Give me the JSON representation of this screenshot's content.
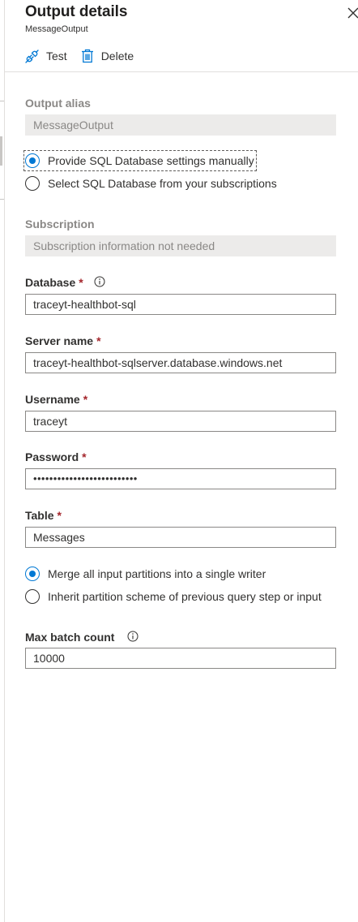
{
  "header": {
    "title": "Output details",
    "subtitle": "MessageOutput"
  },
  "toolbar": {
    "test_label": "Test",
    "delete_label": "Delete"
  },
  "output_alias": {
    "label": "Output alias",
    "value": "MessageOutput"
  },
  "db_source": {
    "options": [
      "Provide SQL Database settings manually",
      "Select SQL Database from your subscriptions"
    ],
    "selected": "Provide SQL Database settings manually"
  },
  "subscription": {
    "label": "Subscription",
    "value": "Subscription information not needed"
  },
  "database": {
    "label": "Database",
    "required_mark": "*",
    "value": "traceyt-healthbot-sql"
  },
  "server_name": {
    "label": "Server name",
    "required_mark": "*",
    "value": "traceyt-healthbot-sqlserver.database.windows.net"
  },
  "username": {
    "label": "Username",
    "required_mark": "*",
    "value": "traceyt"
  },
  "password": {
    "label": "Password",
    "required_mark": "*",
    "value": "••••••••••••••••••••••••••"
  },
  "table": {
    "label": "Table",
    "required_mark": "*",
    "value": "Messages"
  },
  "partitioning": {
    "options": [
      "Merge all input partitions into a single writer",
      "Inherit partition scheme of previous query step or input"
    ],
    "selected": "Merge all input partitions into a single writer"
  },
  "max_batch_count": {
    "label": "Max batch count",
    "value": "10000"
  },
  "colors": {
    "accent": "#0078d4",
    "required": "#a4262c",
    "readonly_bg": "#ecebea"
  },
  "icons": [
    "close-icon",
    "plug-icon",
    "trash-icon",
    "info-icon"
  ]
}
